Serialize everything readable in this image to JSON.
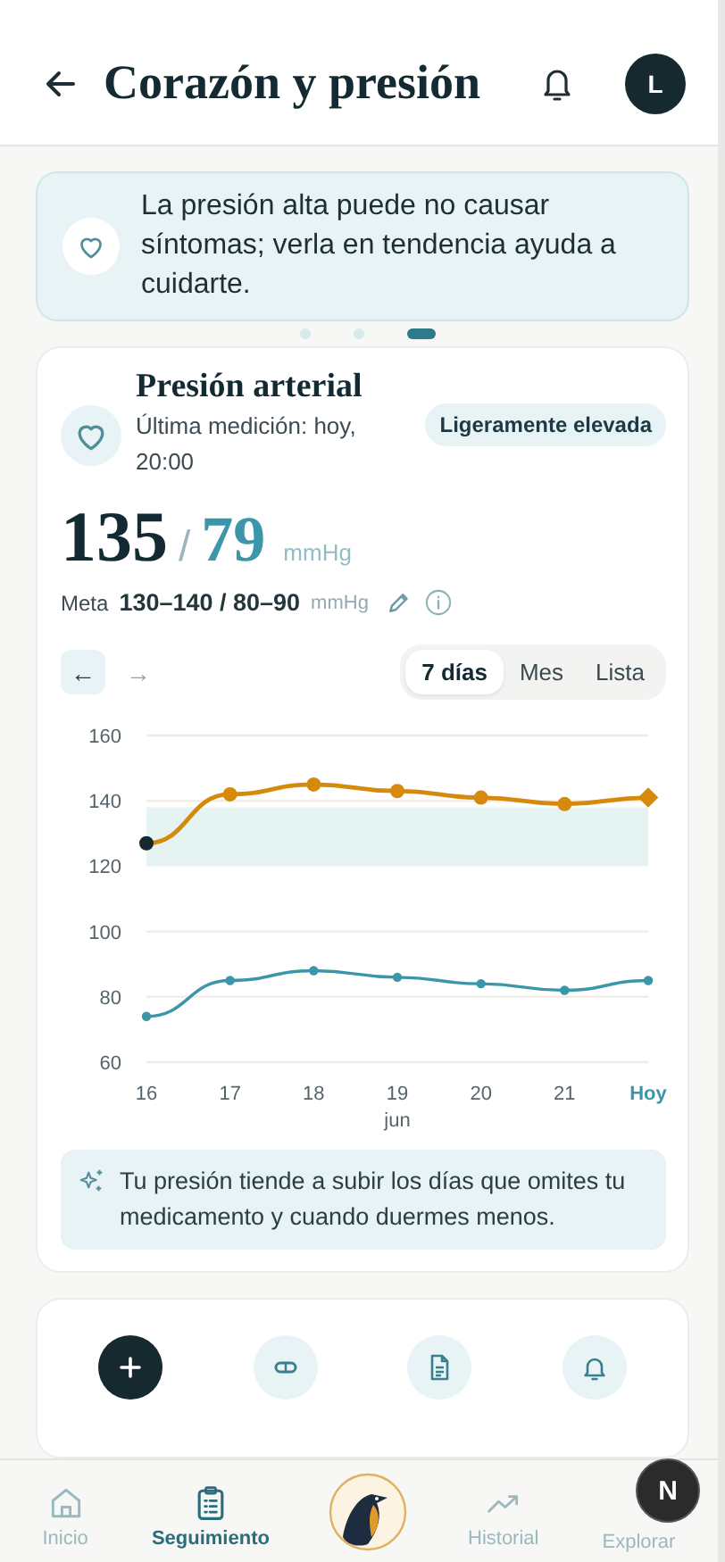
{
  "header": {
    "title": "Corazón y presión",
    "avatar": "L"
  },
  "banner": {
    "text": "La presión alta puede no causar síntomas; verla en tendencia ayuda a cuidarte."
  },
  "pager": [
    {
      "selected": false
    },
    {
      "selected": false
    },
    {
      "selected": true
    }
  ],
  "card": {
    "title": "Presión arterial",
    "subtitle": "Última medición: hoy, 20:00",
    "badge": "Ligeramente elevada",
    "systolic": "135",
    "separator": "/",
    "diastolic": "79",
    "unit": "mmHg",
    "goal_label": "Meta",
    "goal": "130–140 / 80–90",
    "goal_unit": "mmHg",
    "nav": [
      {
        "label": "←",
        "disabled": false
      },
      {
        "label": "→",
        "disabled": true
      }
    ],
    "ranges": [
      {
        "label": "7 días",
        "selected": true
      },
      {
        "label": "Mes",
        "selected": false
      },
      {
        "label": "Lista",
        "selected": false
      }
    ],
    "chart_data": {
      "type": "line",
      "categories": [
        "16",
        "17",
        "18",
        "19",
        "20",
        "21",
        "Hoy"
      ],
      "xlabel": "jun",
      "series": [
        {
          "color": "#d68a0c",
          "marker": "circle",
          "values": [
            127,
            142,
            145,
            143,
            141,
            139,
            141
          ]
        },
        {
          "color": "#3a96a8",
          "marker": "circle",
          "values": [
            74,
            85,
            88,
            86,
            84,
            82,
            85
          ]
        }
      ],
      "ylim": [
        60,
        160
      ],
      "yticks": [
        60,
        80,
        100,
        120,
        140,
        160
      ],
      "grid": true,
      "bands": [
        {
          "axis": "y",
          "from": 120,
          "to": 138
        }
      ]
    },
    "insight": "Tu presión tiende a subir los días que omites tu medicamento y cuando duermes menos."
  },
  "actions": [
    {
      "kind": "add"
    },
    {
      "kind": "pill"
    },
    {
      "kind": "document"
    },
    {
      "kind": "bell"
    }
  ],
  "bottom_nav": [
    {
      "kind": "home",
      "label": "Inicio",
      "selected": false
    },
    {
      "kind": "clipboard",
      "label": "Seguimiento",
      "selected": true
    },
    {
      "kind": "logo"
    },
    {
      "kind": "trend",
      "label": "Historial",
      "selected": false
    },
    {
      "kind": "explore",
      "label": "Explorar",
      "selected": false
    }
  ],
  "dev_badge": "N"
}
